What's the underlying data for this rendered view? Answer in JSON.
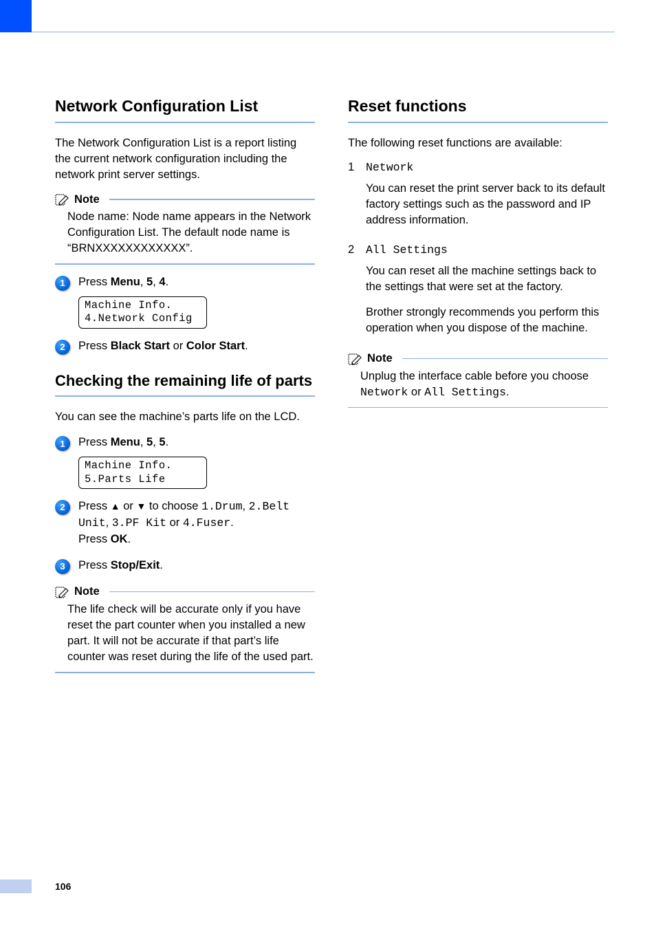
{
  "page_number": "106",
  "left": {
    "section1": {
      "title": "Network Configuration List",
      "intro": "The Network Configuration List is a report listing the current network configuration including the network print server settings.",
      "note_label": "Note",
      "note_body": "Node name: Node name appears in the Network Configuration List. The default node name is “BRNXXXXXXXXXXXX”.",
      "step1_pre": "Press ",
      "step1_b1": "Menu",
      "step1_mid1": ", ",
      "step1_b2": "5",
      "step1_mid2": ", ",
      "step1_b3": "4",
      "step1_post": ".",
      "lcd1_l1": "Machine Info.",
      "lcd1_l2": "4.Network Config",
      "step2_pre": "Press ",
      "step2_b1": "Black Start",
      "step2_mid": " or ",
      "step2_b2": "Color Start",
      "step2_post": "."
    },
    "section2": {
      "title": "Checking the remaining life of parts",
      "intro": "You can see the machine’s parts life on the LCD.",
      "step1_pre": "Press ",
      "step1_b1": "Menu",
      "step1_mid1": ", ",
      "step1_b2": "5",
      "step1_mid2": ", ",
      "step1_b3": "5",
      "step1_post": ".",
      "lcd1_l1": "Machine Info.",
      "lcd1_l2": "5.Parts Life",
      "step2_pre": "Press ",
      "step2_up": "▲",
      "step2_or1": " or ",
      "step2_dn": "▼",
      "step2_mid1": " to choose ",
      "step2_m1": "1.Drum",
      "step2_c1": ", ",
      "step2_m2": "2.Belt Unit",
      "step2_c2": ", ",
      "step2_m3": "3.PF Kit",
      "step2_or2": " or ",
      "step2_m4": "4.Fuser",
      "step2_dot": ".",
      "step2_press": "Press ",
      "step2_ok": "OK",
      "step2_dot2": ".",
      "step3_pre": "Press ",
      "step3_b1": "Stop/Exit",
      "step3_post": ".",
      "note_label": "Note",
      "note_body": "The life check will be accurate only if you have reset the part counter when you installed a new part. It will not be accurate if that part’s life counter was reset during the life of the used part."
    }
  },
  "right": {
    "section1": {
      "title": "Reset functions",
      "intro": "The following reset functions are available:",
      "items": [
        {
          "num": "1",
          "title": "Network",
          "para1": "You can reset the print server back to its default factory settings such as the password and IP address information."
        },
        {
          "num": "2",
          "title": "All Settings",
          "para1": "You can reset all the machine settings back to the settings that were set at the factory.",
          "para2": "Brother strongly recommends you perform this operation when you dispose of the machine."
        }
      ],
      "note_label": "Note",
      "note_pre": "Unplug the interface cable before you choose ",
      "note_m1": "Network",
      "note_or": " or ",
      "note_m2": "All Settings",
      "note_dot": "."
    }
  }
}
